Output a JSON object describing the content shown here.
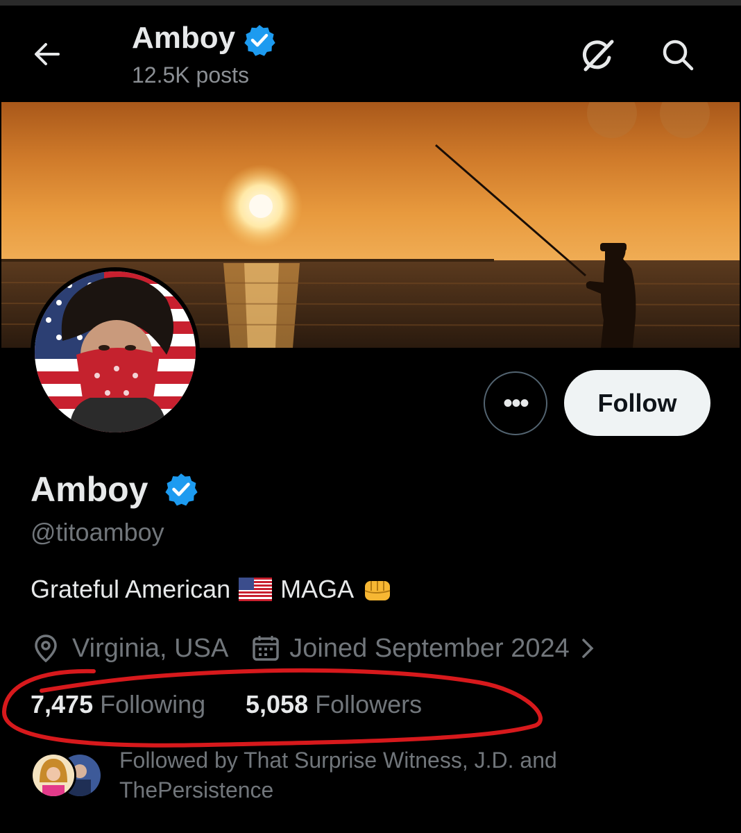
{
  "header": {
    "back_icon": "arrow-left-icon",
    "name": "Amboy",
    "posts": "12.5K posts",
    "grok_icon": "grok-icon",
    "search_icon": "search-icon"
  },
  "profile": {
    "name": "Amboy",
    "handle": "@titoamboy",
    "verified_color": "#1d9bf0",
    "bio_text_1": "Grateful American",
    "bio_text_2": "MAGA",
    "location": "Virginia, USA",
    "joined": "Joined September 2024",
    "following_count": "7,475",
    "following_label": "Following",
    "followers_count": "5,058",
    "followers_label": "Followers",
    "followed_by": "Followed by That Surprise Witness, J.D. and ThePersistence"
  },
  "actions": {
    "more_label": "•••",
    "follow_label": "Follow"
  },
  "colors": {
    "annotation": "#d7191c",
    "follow_bg": "#eff3f4"
  }
}
